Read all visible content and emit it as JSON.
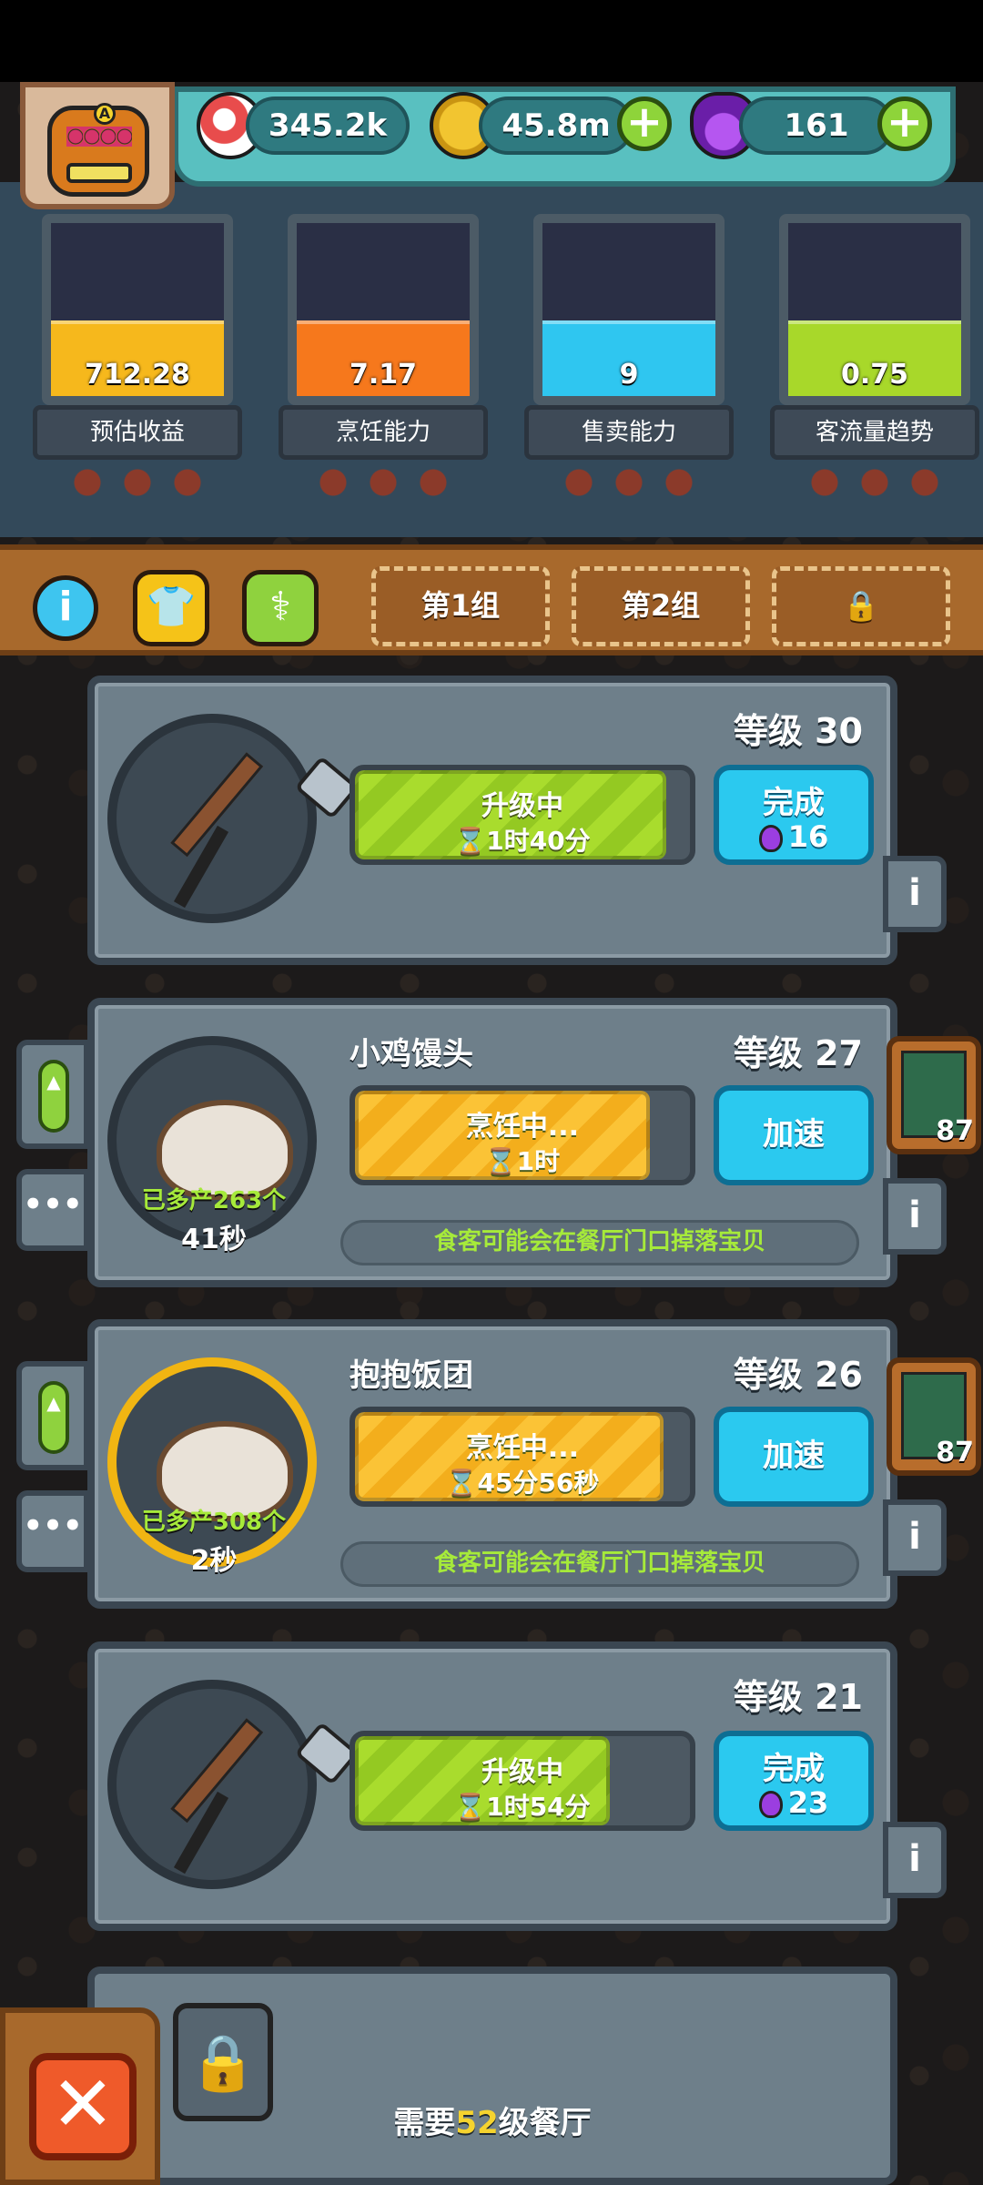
{
  "header": {
    "resources": [
      {
        "name": "eyeball-icon",
        "value": "345.2k"
      },
      {
        "name": "coin-icon",
        "value": "45.8m"
      },
      {
        "name": "potion-icon",
        "value": "161"
      }
    ],
    "avatar_letter": "A"
  },
  "stats": [
    {
      "label": "预估收益",
      "value": "712.28",
      "color": "#f6b81c",
      "fill": 0.33
    },
    {
      "label": "烹饪能力",
      "value": "7.17",
      "color": "#f6781c",
      "fill": 0.33
    },
    {
      "label": "售卖能力",
      "value": "9",
      "color": "#2fc6f0",
      "fill": 0.33
    },
    {
      "label": "客流量趋势",
      "value": "0.75",
      "color": "#a8d82a",
      "fill": 0.33
    }
  ],
  "toolbar": {
    "groups": [
      "第1组",
      "第2组"
    ],
    "lock_icon": "lock-icon"
  },
  "stations": [
    {
      "level": "等级 30",
      "status": "升级中",
      "time": "⌛1时40分",
      "progress": 0.93,
      "bar_style": "green",
      "button": "完成",
      "cost": "16",
      "name": ""
    },
    {
      "name": "小鸡馒头",
      "level": "等级 27",
      "status": "烹饪中...",
      "time": "⌛1时",
      "progress": 0.88,
      "bar_style": "orange",
      "button": "加速",
      "hint": "食客可能会在餐厅门口掉落宝贝",
      "extra": "已多产263个",
      "timer": "41秒",
      "card_count": "87"
    },
    {
      "name": "抱抱饭团",
      "level": "等级 26",
      "status": "烹饪中...",
      "time": "⌛45分56秒",
      "progress": 0.92,
      "bar_style": "orange",
      "button": "加速",
      "hint": "食客可能会在餐厅门口掉落宝贝",
      "extra": "已多产308个",
      "timer": "2秒",
      "card_count": "87"
    },
    {
      "level": "等级 21",
      "status": "升级中",
      "time": "⌛1时54分",
      "progress": 0.76,
      "bar_style": "green",
      "button": "完成",
      "cost": "23",
      "name": ""
    }
  ],
  "locked": {
    "prefix": "需要",
    "level": "52",
    "suffix": "级餐厅"
  },
  "close_label": "✕"
}
